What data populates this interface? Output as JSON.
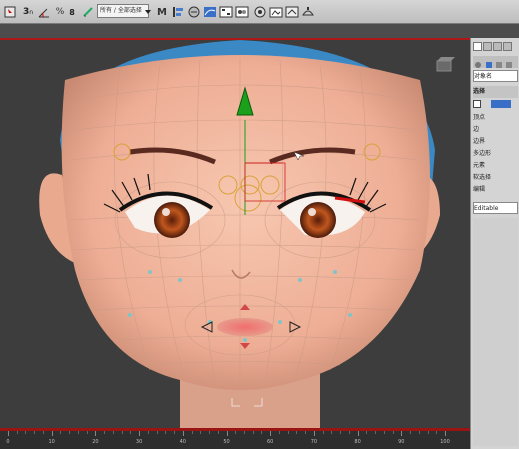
{
  "toolbar": {
    "selection_filter": "所有 / 全部选择"
  },
  "command_panel": {
    "object_name": "对象名",
    "rollout_title": "选择",
    "rows": [
      "顶点",
      "边",
      "边界",
      "多边形",
      "元素",
      "软选择",
      "编辑"
    ],
    "modifier_label": "Editable"
  },
  "timeline": {
    "ticks": [
      "0",
      "10",
      "20",
      "30",
      "40",
      "50",
      "60",
      "70",
      "80",
      "90",
      "100"
    ]
  },
  "colors": {
    "viewport_bg": "#3d3d3d",
    "accent_red": "#b01818",
    "skin": "#f2bba2",
    "hair": "#3a88c4",
    "gizmo_green": "#1aa01a"
  }
}
